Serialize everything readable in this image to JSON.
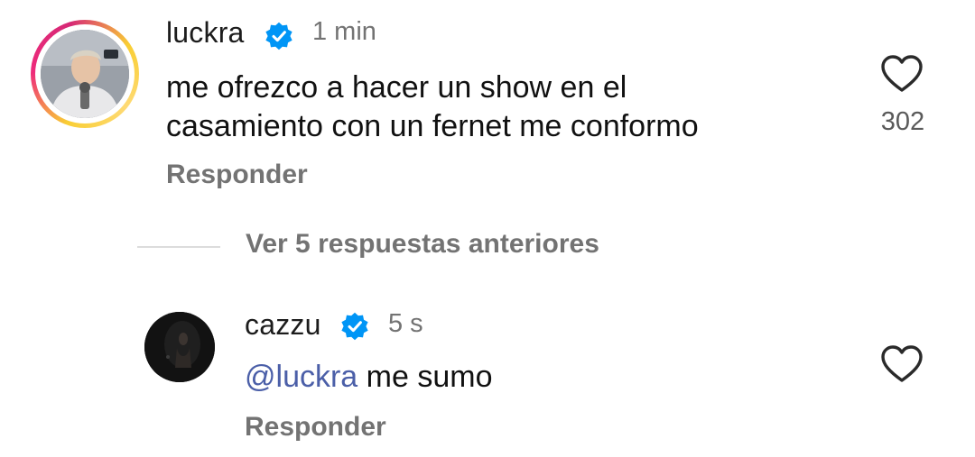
{
  "comments": [
    {
      "username": "luckra",
      "time": "1 min",
      "text_line1": "me ofrezco a hacer un show en el",
      "text_line2": "casamiento con un fernet me conformo",
      "reply_label": "Responder",
      "like_count": "302"
    },
    {
      "username": "cazzu",
      "time": "5 s",
      "mention": "@luckra",
      "text": " me sumo",
      "reply_label": "Responder"
    }
  ],
  "view_replies_label": "Ver 5 respuestas anteriores",
  "icons": {
    "verified": "verified-badge-icon",
    "like": "heart-icon",
    "mention": "threads-icon"
  },
  "colors": {
    "verified_blue": "#0095f6",
    "secondary_text": "#737373",
    "mention_link": "#4b5fa8",
    "story_ring_start": "#f9ce34",
    "story_ring_end": "#ee2a7b"
  }
}
